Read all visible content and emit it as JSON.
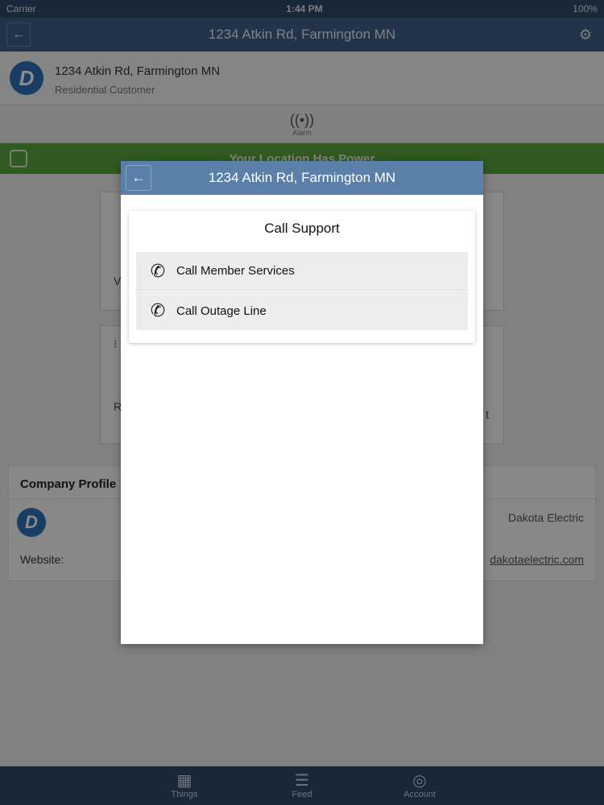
{
  "status_bar": {
    "carrier": "Carrier",
    "time": "1:44 PM",
    "battery": "100%"
  },
  "nav": {
    "title": "1234 Atkin Rd, Farmington MN",
    "back_icon": "←",
    "settings_icon": "⚙"
  },
  "customer": {
    "logo_glyph": "D",
    "address": "1234 Atkin Rd, Farmington MN",
    "type": "Residential Customer"
  },
  "alarm": {
    "icon": "((•))",
    "label": "Alarm"
  },
  "power_banner": {
    "text": "Your Location Has Power"
  },
  "cards": {
    "card_a_left": "V",
    "card_b_left_icon": "⁝",
    "card_b_left": "R",
    "card_b_right": "t"
  },
  "company_profile": {
    "title": "Company Profile",
    "logo_glyph": "D",
    "company_name": "Dakota Electric",
    "website_label": "Website:",
    "website_value": "dakotaelectric.com"
  },
  "tabs": [
    {
      "icon": "▦",
      "label": "Things"
    },
    {
      "icon": "☰",
      "label": "Feed"
    },
    {
      "icon": "◎",
      "label": "Account"
    }
  ],
  "modal": {
    "title": "1234 Atkin Rd, Farmington MN",
    "back_icon": "←",
    "panel_title": "Call Support",
    "items": [
      {
        "icon": "✆",
        "label": "Call Member Services"
      },
      {
        "icon": "✆",
        "label": "Call Outage Line"
      }
    ]
  },
  "colors": {
    "nav": "#3e5f86",
    "modal_header": "#5a7fa8",
    "power_banner": "#58a43c",
    "brand_logo": "#2f6fb5"
  }
}
